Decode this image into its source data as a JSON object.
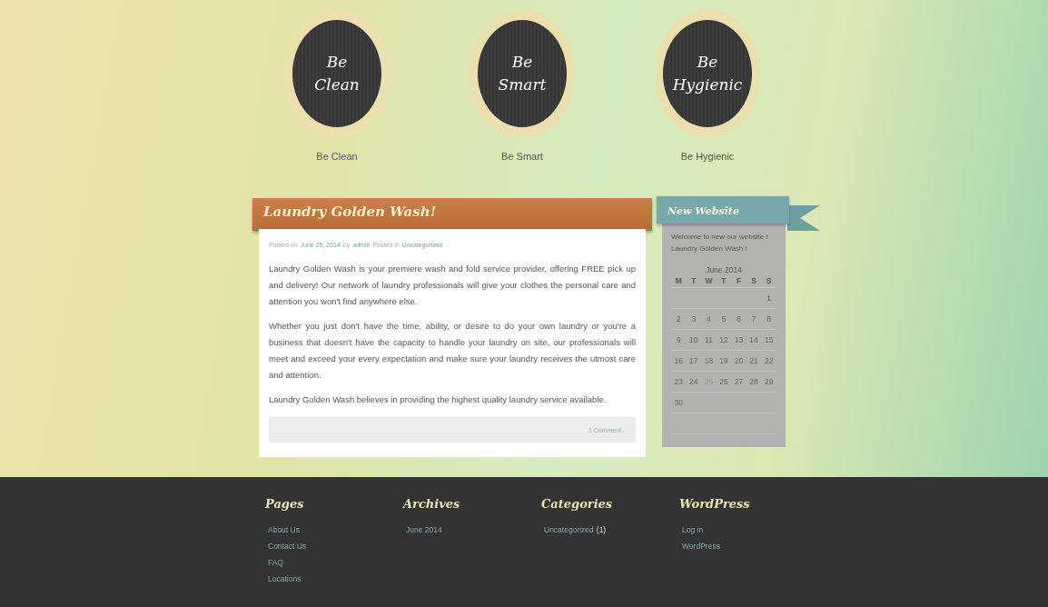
{
  "features": [
    {
      "badge_lines": [
        "Be",
        "Clean"
      ],
      "label": "Be Clean"
    },
    {
      "badge_lines": [
        "Be",
        "Smart"
      ],
      "label": "Be Smart"
    },
    {
      "badge_lines": [
        "Be",
        "Hygienic"
      ],
      "label": "Be Hygienic"
    }
  ],
  "post": {
    "title": "Laundry Golden Wash!",
    "meta": [
      {
        "kind": "text",
        "text": "Posted on"
      },
      {
        "kind": "link",
        "text": "June 25, 2014"
      },
      {
        "kind": "text",
        "text": "by"
      },
      {
        "kind": "link",
        "text": "admin"
      },
      {
        "kind": "text",
        "text": "Posted in"
      },
      {
        "kind": "link",
        "text": "Uncategorized"
      },
      {
        "kind": "text",
        "text": "."
      }
    ],
    "paragraphs": [
      "Laundry Golden Wash is your premiere wash and fold service provider, offering FREE pick up and delivery!  Our network of laundry professionals will give your clothes the personal care and attention you won't find anywhere else.",
      "Whether you just don't have the time, ability, or desire to do your own laundry or you're a business that doesn't have the capacity to handle your laundry on site, our professionals will meet and exceed your every expectation and make sure your laundry receives the utmost care and attention.",
      "Laundry Golden Wash believes in providing the highest quality laundry service available."
    ],
    "comments": "1 Comment ."
  },
  "sidebar": {
    "title": "New Website",
    "text": "Welcome to new our website ! Laundry Golden Wash !",
    "calendar": {
      "caption": "June 2014",
      "weekdays": [
        "M",
        "T",
        "W",
        "T",
        "F",
        "S",
        "S"
      ],
      "weeks": [
        {
          "kind": "lead",
          "days": [
            {
              "day": "1",
              "selected": false
            }
          ]
        },
        {
          "kind": "full",
          "days": [
            {
              "day": "2",
              "selected": false
            },
            {
              "day": "3",
              "selected": false
            },
            {
              "day": "4",
              "selected": false
            },
            {
              "day": "5",
              "selected": false
            },
            {
              "day": "6",
              "selected": false
            },
            {
              "day": "7",
              "selected": false
            },
            {
              "day": "8",
              "selected": false
            }
          ]
        },
        {
          "kind": "full",
          "days": [
            {
              "day": "9",
              "selected": false
            },
            {
              "day": "10",
              "selected": false
            },
            {
              "day": "11",
              "selected": false
            },
            {
              "day": "12",
              "selected": false
            },
            {
              "day": "13",
              "selected": false
            },
            {
              "day": "14",
              "selected": false
            },
            {
              "day": "15",
              "selected": false
            }
          ]
        },
        {
          "kind": "full",
          "days": [
            {
              "day": "16",
              "selected": false
            },
            {
              "day": "17",
              "selected": false
            },
            {
              "day": "18",
              "selected": false
            },
            {
              "day": "19",
              "selected": false
            },
            {
              "day": "20",
              "selected": false
            },
            {
              "day": "21",
              "selected": false
            },
            {
              "day": "22",
              "selected": false
            }
          ]
        },
        {
          "kind": "full",
          "days": [
            {
              "day": "23",
              "selected": false
            },
            {
              "day": "24",
              "selected": false
            },
            {
              "day": "25",
              "selected": true
            },
            {
              "day": "26",
              "selected": false
            },
            {
              "day": "27",
              "selected": false
            },
            {
              "day": "28",
              "selected": false
            },
            {
              "day": "29",
              "selected": false
            }
          ]
        },
        {
          "kind": "tail",
          "days": [
            {
              "day": "30",
              "selected": false
            }
          ]
        }
      ]
    }
  },
  "footer": [
    {
      "title": "Pages",
      "links": [
        {
          "text": "About Us"
        },
        {
          "text": "Contact Us"
        },
        {
          "text": "FAQ"
        },
        {
          "text": "Locations"
        }
      ]
    },
    {
      "title": "Archives",
      "links": [
        {
          "text": "June 2014"
        }
      ]
    },
    {
      "title": "Categories",
      "links": [
        {
          "text": "Uncategorized",
          "count": "(1)"
        }
      ]
    },
    {
      "title": "WordPress",
      "links": [
        {
          "text": "Log in"
        },
        {
          "text": "WordPress"
        }
      ]
    }
  ]
}
